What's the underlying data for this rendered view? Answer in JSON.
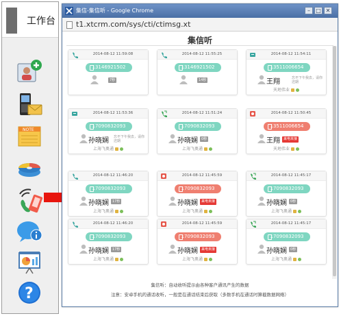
{
  "dock": {
    "title": "工作台",
    "items": [
      {
        "icon": "add-contact-icon"
      },
      {
        "icon": "phone-message-icon"
      },
      {
        "icon": "note-icon"
      },
      {
        "icon": "disk-icon"
      },
      {
        "icon": "mobile-call-icon"
      },
      {
        "icon": "info-chat-icon"
      },
      {
        "icon": "presentation-icon"
      },
      {
        "icon": "help-icon"
      }
    ]
  },
  "window": {
    "title": "集信-集信听 - Google Chrome",
    "url": "t1.xtcrm.com/sys/cti/ctimsg.xt",
    "buttons": {
      "minimize": "–",
      "maximize": "□",
      "close": "✕"
    }
  },
  "page": {
    "title": "集信听",
    "footer_line1": "集信听：自动收听提示由各种客户通讯产生的数据",
    "footer_line2": "注意：安卓手机的通话收听，一般是在通话结束后获取（多数手机在通话时算截数据网络）"
  },
  "colors": {
    "pill_green": "#7fd6c1",
    "pill_red": "#ef7f70",
    "badge_red": "#e53935",
    "arrow": "#e8150d"
  },
  "cards": [
    {
      "time": "2014-08-12 11:59:08",
      "icon": "phone-in-icon",
      "number": "13146921502",
      "pill": "green",
      "name": "",
      "duration": "7秒",
      "note": "",
      "badge": "",
      "footer": ""
    },
    {
      "time": "2014-08-12 11:55:25",
      "icon": "phone-in-icon",
      "number": "13146921502",
      "pill": "green",
      "name": "",
      "duration": "14秒",
      "note": "",
      "badge": "",
      "footer": ""
    },
    {
      "time": "2014-08-12 11:54:11",
      "icon": "sms-icon",
      "number": "13511006654",
      "pill": "green",
      "name": "王翔",
      "duration": "",
      "note": "忘不下午我去，请你还期",
      "badge": "",
      "footer": "天地伟业"
    },
    {
      "time": "2014-08-12 11:53:36",
      "icon": "sms-icon",
      "number": "17090832093",
      "pill": "green",
      "name": "孙晓娴",
      "duration": "",
      "note": "忘不下午我去，请你还期",
      "badge": "",
      "footer": "上海飞奥通"
    },
    {
      "time": "2014-08-12 11:51:24",
      "icon": "phone-out-icon",
      "number": "17090832093",
      "pill": "green",
      "name": "孙晓娴",
      "duration": "0秒",
      "note": "",
      "badge": "",
      "footer": "上海飞奥通"
    },
    {
      "time": "2014-08-12 11:50:45",
      "icon": "missed-call-icon",
      "number": "13511006654",
      "pill": "red",
      "name": "王翔",
      "duration": "",
      "note": "",
      "badge": "来电未接",
      "footer": "天地伟业"
    },
    {
      "time": "2014-08-12 11:46:20",
      "icon": "phone-in-icon",
      "number": "17090832093",
      "pill": "green",
      "name": "孙晓娴",
      "duration": "17秒",
      "note": "",
      "badge": "",
      "footer": "上海飞奥通"
    },
    {
      "time": "2014-08-12 11:45:59",
      "icon": "missed-call-icon",
      "number": "17090832093",
      "pill": "red",
      "name": "孙晓娴",
      "duration": "",
      "note": "",
      "badge": "来电未接",
      "footer": "上海飞奥通"
    },
    {
      "time": "2014-08-12 11:45:17",
      "icon": "phone-out-icon",
      "number": "17090832093",
      "pill": "green",
      "name": "孙晓娴",
      "duration": "0秒",
      "note": "",
      "badge": "",
      "footer": "上海飞奥通"
    },
    {
      "time": "2014-08-12 11:46:20",
      "icon": "phone-in-icon",
      "number": "17090832093",
      "pill": "green",
      "name": "孙晓娴",
      "duration": "17秒",
      "note": "",
      "badge": "",
      "footer": "上海飞奥通"
    },
    {
      "time": "2014-08-12 11:45:59",
      "icon": "missed-call-icon",
      "number": "17090832093",
      "pill": "red",
      "name": "孙晓娴",
      "duration": "",
      "note": "",
      "badge": "来电未接",
      "footer": "上海飞奥通"
    },
    {
      "time": "2014-08-12 11:45:17",
      "icon": "phone-out-icon",
      "number": "17090832093",
      "pill": "green",
      "name": "孙晓娴",
      "duration": "0秒",
      "note": "",
      "badge": "",
      "footer": "上海飞奥通"
    }
  ]
}
